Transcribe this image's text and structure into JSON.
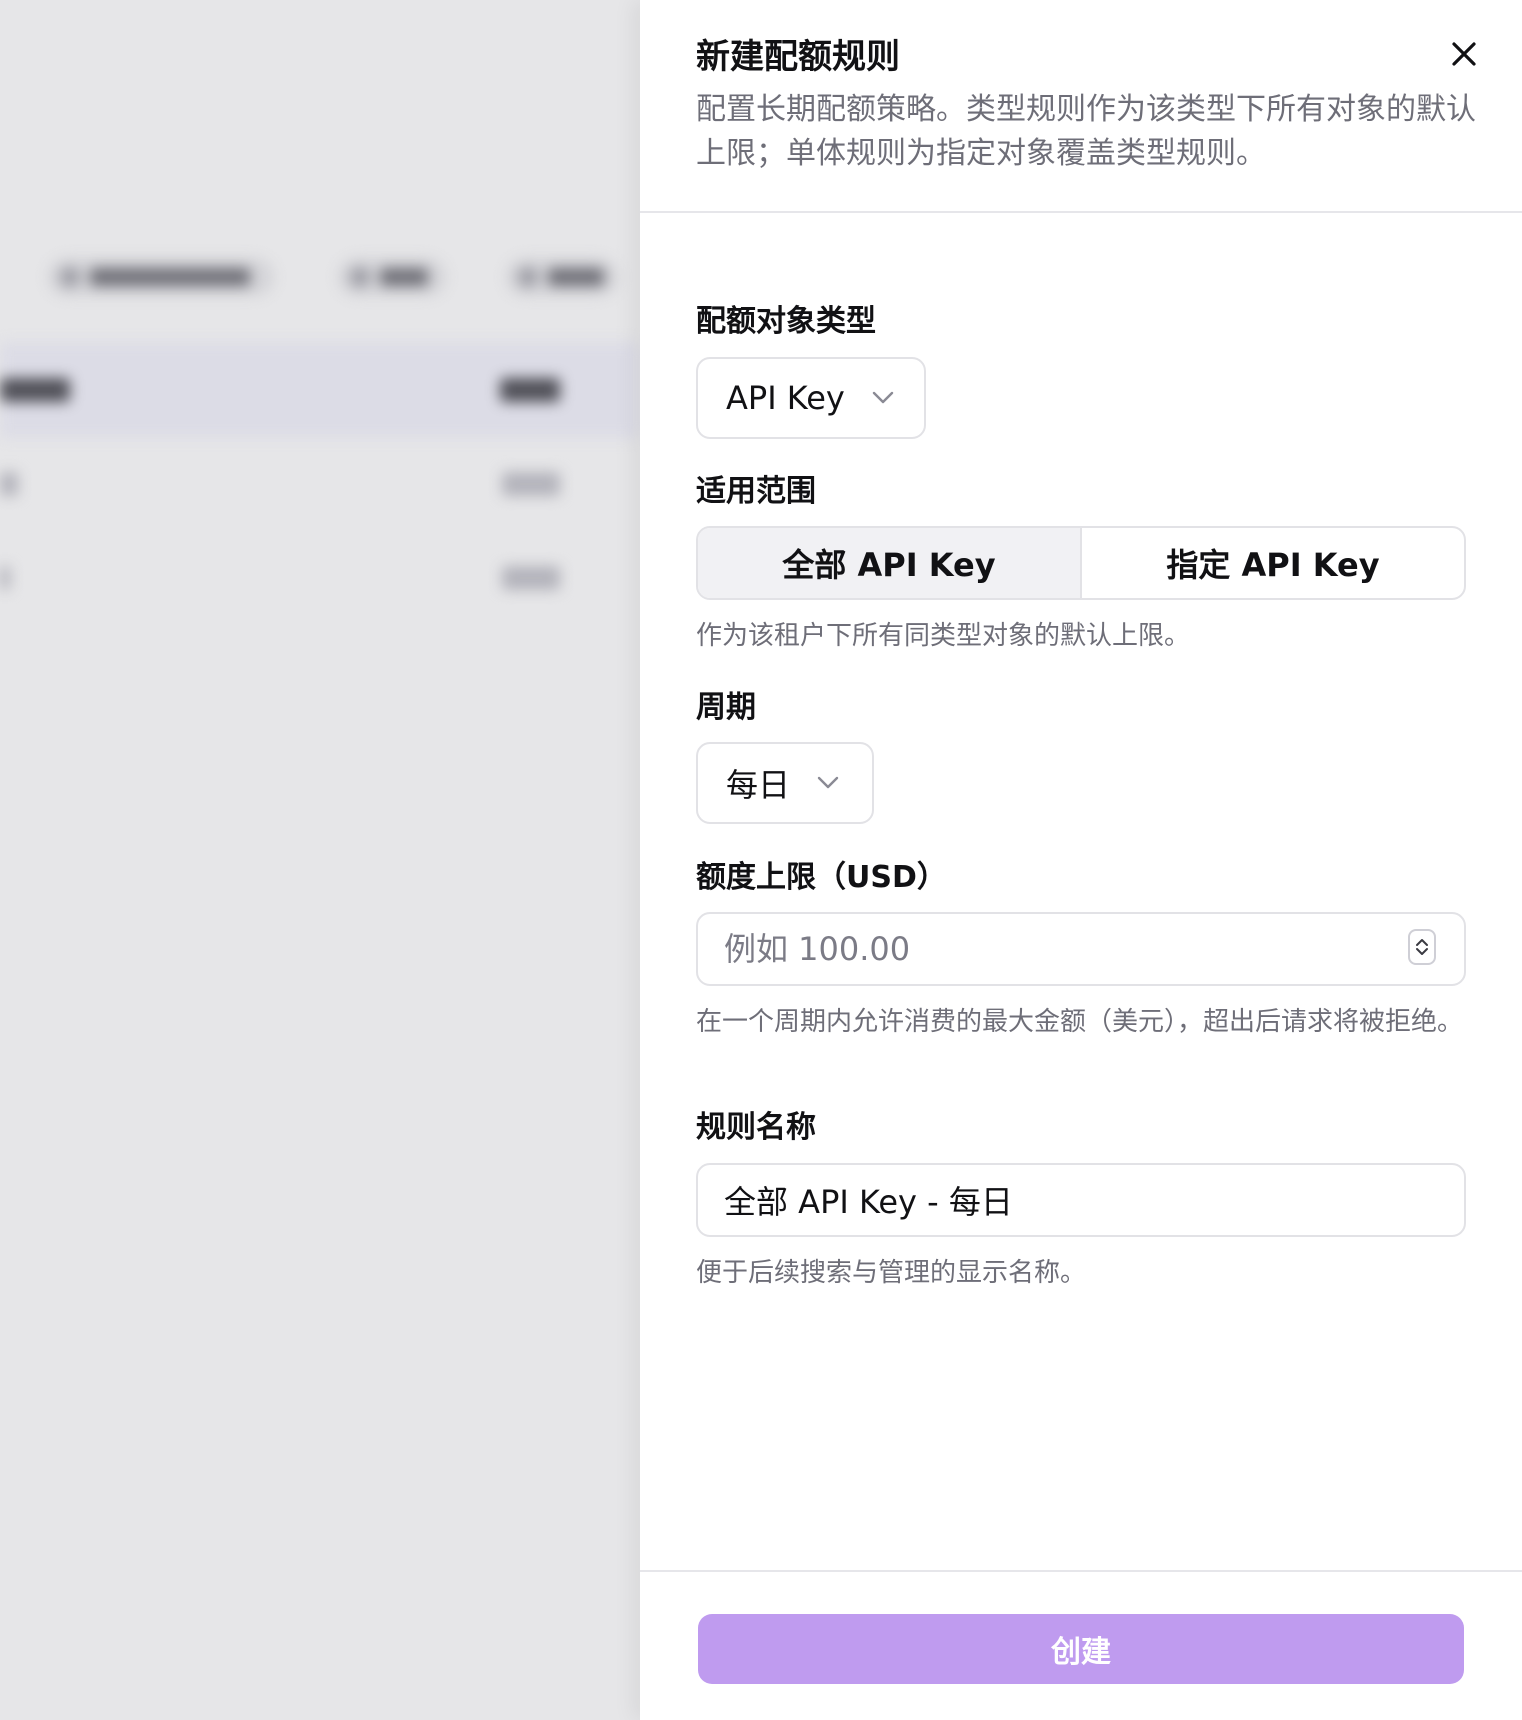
{
  "drawer": {
    "title": "新建配额规则",
    "description": "配置长期配额策略。类型规则作为该类型下所有对象的默认上限；单体规则为指定对象覆盖类型规则。",
    "close_icon": "close-icon"
  },
  "form": {
    "object_type": {
      "label": "配额对象类型",
      "value": "API Key"
    },
    "scope": {
      "label": "适用范围",
      "options": [
        {
          "label": "全部 API Key",
          "selected": true
        },
        {
          "label": "指定 API Key",
          "selected": false
        }
      ],
      "hint": "作为该租户下所有同类型对象的默认上限。"
    },
    "period": {
      "label": "周期",
      "value": "每日"
    },
    "limit": {
      "label": "额度上限（USD）",
      "value": "",
      "placeholder": "例如 100.00",
      "hint": "在一个周期内允许消费的最大金额（美元），超出后请求将被拒绝。"
    },
    "rule_name": {
      "label": "规则名称",
      "value": "全部 API Key - 每日",
      "hint": "便于后续搜索与管理的显示名称。"
    }
  },
  "footer": {
    "create_label": "创建"
  },
  "colors": {
    "primary_disabled": "#bf9bef",
    "border": "#e2e2e6",
    "muted_text": "#6e6e78"
  }
}
